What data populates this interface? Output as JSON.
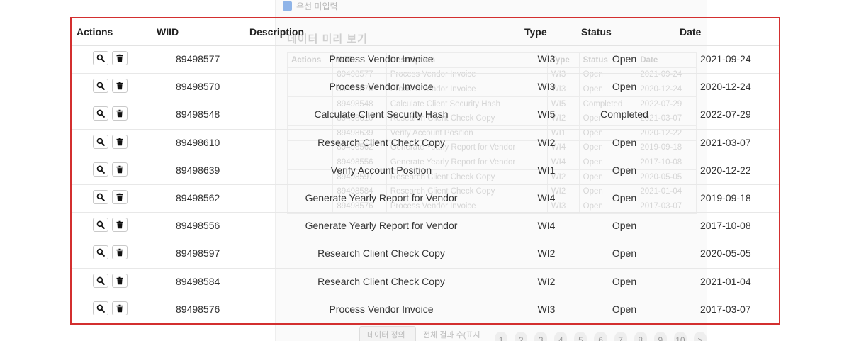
{
  "background_modal": {
    "checkbox_label": "우선 미입력",
    "title": "데이터 미리 보기",
    "columns": [
      "Actions",
      "WIID",
      "Description",
      "Type",
      "Status",
      "Date"
    ],
    "rows": [
      [
        "",
        "89498577",
        "Process Vendor Invoice",
        "WI3",
        "Open",
        "2021-09-24"
      ],
      [
        "",
        "89498570",
        "Process Vendor Invoice",
        "WI3",
        "Open",
        "2020-12-24"
      ],
      [
        "",
        "89498548",
        "Calculate Client Security Hash",
        "WI5",
        "Completed",
        "2022-07-29"
      ],
      [
        "",
        "89498610",
        "Research Client Check Copy",
        "WI2",
        "Open",
        "2021-03-07"
      ],
      [
        "",
        "89498639",
        "Verify Account Position",
        "WI1",
        "Open",
        "2020-12-22"
      ],
      [
        "",
        "89498562",
        "Generate Yearly Report for Vendor",
        "WI4",
        "Open",
        "2019-09-18"
      ],
      [
        "",
        "89498556",
        "Generate Yearly Report for Vendor",
        "WI4",
        "Open",
        "2017-10-08"
      ],
      [
        "",
        "89498597",
        "Research Client Check Copy",
        "WI2",
        "Open",
        "2020-05-05"
      ],
      [
        "",
        "89498584",
        "Research Client Check Copy",
        "WI2",
        "Open",
        "2021-01-04"
      ],
      [
        "",
        "89498576",
        "Process Vendor Invoice",
        "WI3",
        "Open",
        "2017-03-07"
      ]
    ],
    "pager": {
      "button_label": "데이터 정의 편집",
      "info": "전체 결과 수(표시 결과 수)",
      "pages": [
        "1",
        "2",
        "3",
        "4",
        "5",
        "6",
        "7",
        "8",
        "9",
        "10",
        ">"
      ]
    }
  },
  "table": {
    "headers": {
      "actions": "Actions",
      "wiid": "WIID",
      "description": "Description",
      "type": "Type",
      "status": "Status",
      "date": "Date"
    },
    "rows": [
      {
        "wiid": "89498577",
        "description": "Process Vendor Invoice",
        "type": "WI3",
        "status": "Open",
        "date": "2021-09-24"
      },
      {
        "wiid": "89498570",
        "description": "Process Vendor Invoice",
        "type": "WI3",
        "status": "Open",
        "date": "2020-12-24"
      },
      {
        "wiid": "89498548",
        "description": "Calculate Client Security Hash",
        "type": "WI5",
        "status": "Completed",
        "date": "2022-07-29"
      },
      {
        "wiid": "89498610",
        "description": "Research Client Check Copy",
        "type": "WI2",
        "status": "Open",
        "date": "2021-03-07"
      },
      {
        "wiid": "89498639",
        "description": "Verify Account Position",
        "type": "WI1",
        "status": "Open",
        "date": "2020-12-22"
      },
      {
        "wiid": "89498562",
        "description": "Generate Yearly Report for Vendor",
        "type": "WI4",
        "status": "Open",
        "date": "2019-09-18"
      },
      {
        "wiid": "89498556",
        "description": "Generate Yearly Report for Vendor",
        "type": "WI4",
        "status": "Open",
        "date": "2017-10-08"
      },
      {
        "wiid": "89498597",
        "description": "Research Client Check Copy",
        "type": "WI2",
        "status": "Open",
        "date": "2020-05-05"
      },
      {
        "wiid": "89498584",
        "description": "Research Client Check Copy",
        "type": "WI2",
        "status": "Open",
        "date": "2021-01-04"
      },
      {
        "wiid": "89498576",
        "description": "Process Vendor Invoice",
        "type": "WI3",
        "status": "Open",
        "date": "2017-03-07"
      }
    ],
    "row_actions": [
      "search-icon",
      "trash-icon"
    ]
  },
  "colors": {
    "highlight_border": "#d32f2f"
  }
}
